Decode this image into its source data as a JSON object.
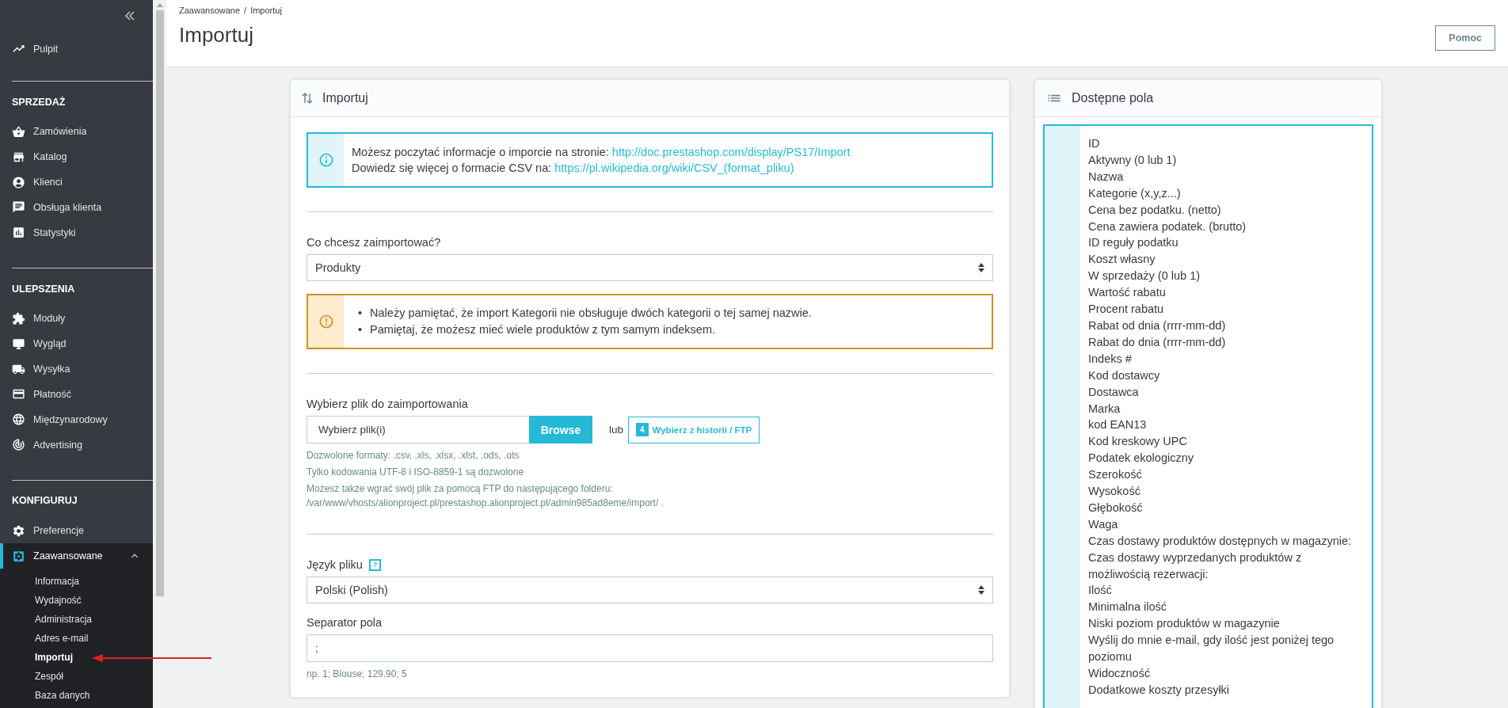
{
  "sidebar": {
    "top_items": [
      {
        "label": "Pulpit",
        "selected": false
      }
    ],
    "sections": [
      {
        "heading": "SPRZEDAŻ",
        "items": [
          {
            "label": "Zamówienia",
            "selected": false
          },
          {
            "label": "Katalog",
            "selected": false
          },
          {
            "label": "Klienci",
            "selected": false
          },
          {
            "label": "Obsługa klienta",
            "selected": false
          },
          {
            "label": "Statystyki",
            "selected": false
          }
        ]
      },
      {
        "heading": "ULEPSZENIA",
        "items": [
          {
            "label": "Moduły",
            "selected": false
          },
          {
            "label": "Wygląd",
            "selected": false
          },
          {
            "label": "Wysyłka",
            "selected": false
          },
          {
            "label": "Płatność",
            "selected": false
          },
          {
            "label": "Międzynarodowy",
            "selected": false
          },
          {
            "label": "Advertising",
            "selected": false
          }
        ]
      },
      {
        "heading": "KONFIGURUJ",
        "items": [
          {
            "label": "Preferencje",
            "selected": false
          },
          {
            "label": "Zaawansowane",
            "selected": true,
            "expanded": true,
            "children": [
              {
                "label": "Informacja",
                "selected": false
              },
              {
                "label": "Wydajność",
                "selected": false
              },
              {
                "label": "Administracja",
                "selected": false
              },
              {
                "label": "Adres e-mail",
                "selected": false
              },
              {
                "label": "Importuj",
                "selected": true
              },
              {
                "label": "Zespół",
                "selected": false
              },
              {
                "label": "Baza danych",
                "selected": false
              }
            ]
          }
        ]
      }
    ]
  },
  "header": {
    "breadcrumb": [
      "Zaawansowane",
      "Importuj"
    ],
    "breadcrumb_separator": "/",
    "title": "Importuj",
    "help_button": "Pomoc"
  },
  "import_panel": {
    "title": "Importuj",
    "info_alert": [
      {
        "text": "Możesz poczytać informacje o imporcie na stronie:",
        "link": "http://doc.prestashop.com/display/PS17/Import"
      },
      {
        "text": "Dowiedz się więcej o formacie CSV na:",
        "link": "https://pl.wikipedia.org/wiki/CSV_(format_pliku)"
      }
    ],
    "entity_label": "Co chcesz zaimportować?",
    "entity_value": "Produkty",
    "warning_alert": [
      {
        "marker": "•",
        "text": "Należy pamiętać, że import Kategorii nie obsługuje dwóch kategorii o tej samej nazwie."
      },
      {
        "marker": "•",
        "text": "Pamiętaj, że możesz mieć wiele produktów z tym samym indeksem."
      }
    ],
    "file_label": "Wybierz plik do zaimportowania",
    "file_placeholder": "Wybierz plik(i)",
    "browse_button": "Browse",
    "or_text": "lub",
    "history_count": "4",
    "history_button": "Wybierz z historii / FTP",
    "file_help": [
      "Dozwolone formaty: .csv, .xls, .xlsx, .xlst, .ods, .ots",
      "Tylko kodowania UTF-8 i ISO-8859-1 są dozwolone",
      "Możesz także wgrać swój plik za pomocą FTP do następującego folderu:\n/var/www/vhosts/alionproject.pl/prestashop.alionproject.pl/admin985ad8eme/import/ ."
    ],
    "language_label": "Język pliku",
    "language_help": "?",
    "language_value": "Polski (Polish)",
    "separator_label": "Separator pola",
    "separator_value": ";",
    "separator_hint": "np. 1; Blouse; 129.90; 5"
  },
  "fields_panel": {
    "title": "Dostępne pola",
    "fields": [
      "ID",
      "Aktywny (0 lub 1)",
      "Nazwa",
      "Kategorie (x,y,z...)",
      "Cena bez podatku. (netto)",
      "Cena zawiera podatek. (brutto)",
      "ID reguły podatku",
      "Koszt własny",
      "W sprzedaży (0 lub 1)",
      "Wartość rabatu",
      "Procent rabatu",
      "Rabat od dnia (rrrr-mm-dd)",
      "Rabat do dnia (rrrr-mm-dd)",
      "Indeks #",
      "Kod dostawcy",
      "Dostawca",
      "Marka",
      "kod EAN13",
      "Kod kreskowy UPC",
      "Podatek ekologiczny",
      "Szerokość",
      "Wysokość",
      "Głębokość",
      "Waga",
      "Czas dostawy produktów dostępnych w magazynie:",
      "Czas dostawy wyprzedanych produktów z możliwością rezerwacji:",
      "Ilość",
      "Minimalna ilość",
      "Niski poziom produktów w magazynie",
      "Wyślij do mnie e-mail, gdy ilość jest poniżej tego poziomu",
      "Widoczność",
      "Dodatkowe koszty przesyłki"
    ]
  }
}
